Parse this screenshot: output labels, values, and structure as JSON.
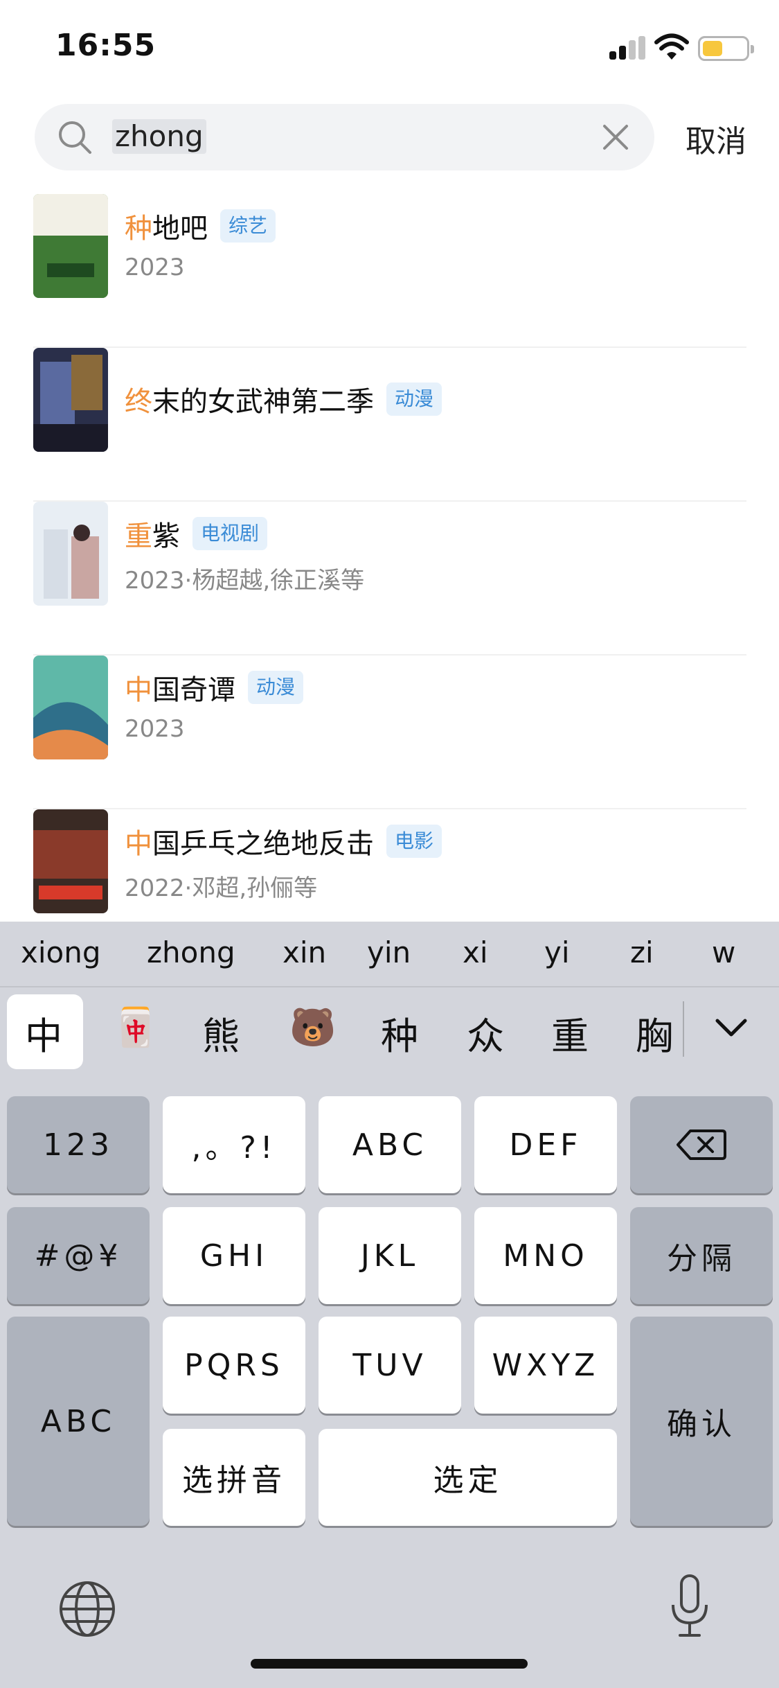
{
  "status_bar": {
    "time": "16:55",
    "battery_color": "#f7c73d"
  },
  "search": {
    "query": "zhong",
    "cancel_label": "取消",
    "icon": "search-icon",
    "clear_icon": "close-icon"
  },
  "results": [
    {
      "title_first": "种",
      "title_rest": "地吧",
      "tag": "综艺",
      "subtitle": "2023"
    },
    {
      "title_first": "终",
      "title_rest": "末的女武神第二季",
      "tag": "动漫",
      "subtitle": ""
    },
    {
      "title_first": "重",
      "title_rest": "紫",
      "tag": "电视剧",
      "subtitle": "2023·杨超越,徐正溪等"
    },
    {
      "title_first": "中",
      "title_rest": "国奇谭",
      "tag": "动漫",
      "subtitle": "2023"
    },
    {
      "title_first": "中",
      "title_rest": "国乒乓之绝地反击",
      "tag": "电影",
      "subtitle": "2022·邓超,孙俪等"
    }
  ],
  "keyboard": {
    "pinyin_options": [
      "xiong",
      "zhong",
      "xin",
      "yin",
      "xi",
      "yi",
      "zi",
      "w"
    ],
    "candidates": [
      "中",
      "🀄",
      "熊",
      "🐻",
      "种",
      "众",
      "重",
      "胸"
    ],
    "keys": {
      "num": "123",
      "punct": ",。?!",
      "abc": "ABC",
      "def": "DEF",
      "symbols": "#@¥",
      "ghi": "GHI",
      "jkl": "JKL",
      "mno": "MNO",
      "separator": "分隔",
      "mode_abc": "ABC",
      "pqrs": "PQRS",
      "tuv": "TUV",
      "wxyz": "WXYZ",
      "confirm": "确认",
      "select_pinyin": "选拼音",
      "select": "选定"
    }
  },
  "colors": {
    "highlight": "#f0913c",
    "tag_text": "#3a8bd6",
    "tag_bg": "#e6f1fb",
    "keyboard_bg": "#d3d5dc"
  }
}
